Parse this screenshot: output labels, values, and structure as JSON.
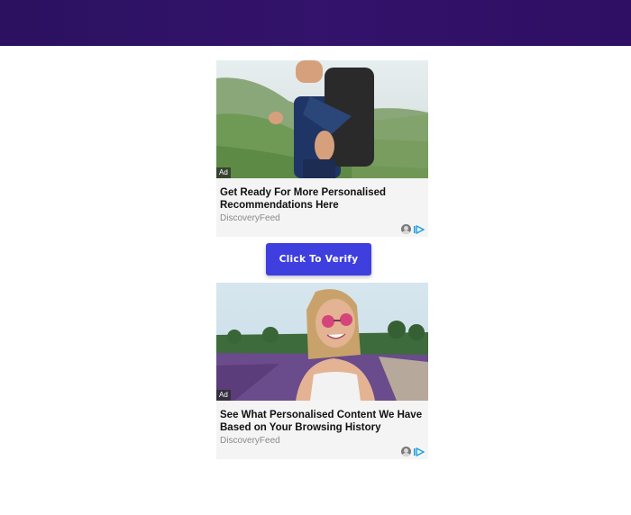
{
  "ads": [
    {
      "badge": "Ad",
      "title": "Get Ready For More Personalised Recommendations Here",
      "source": "DiscoveryFeed",
      "image": "hiker-reaching-hand-photo"
    },
    {
      "badge": "Ad",
      "title": "See What Personalised Content We Have Based on Your Browsing History",
      "source": "DiscoveryFeed",
      "image": "woman-pink-sunglasses-lavender-photo"
    }
  ],
  "verify_button": {
    "label": "Click To Verify"
  },
  "icons": {
    "privacy": "user-icon",
    "adchoices": "adchoices-icon"
  },
  "colors": {
    "topbar": "#2e0f63",
    "button": "#3f3fe0"
  }
}
